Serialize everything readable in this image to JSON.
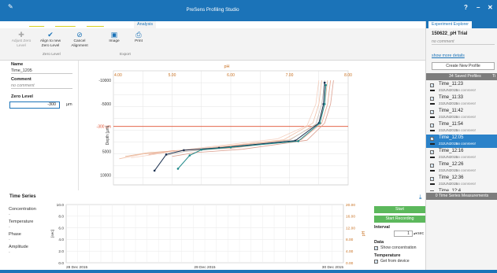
{
  "app": {
    "title": "PreSens Profiling Studio",
    "help": "?",
    "minimize": "–",
    "close": "✕"
  },
  "tabs": [
    {
      "label": "File"
    },
    {
      "label": "Devices"
    },
    {
      "label": "Calibration"
    },
    {
      "label": "Template"
    },
    {
      "label": "Profile"
    },
    {
      "label": "Analysis"
    }
  ],
  "ribbon": {
    "adjust_zero_level": "Adjust Zero Level",
    "align_to_new_zero_level": "Align to new Zero Level",
    "cancel_alignment": "Cancel Alignment",
    "image": "Image",
    "print": "Print",
    "group_zero_level": "Zero Level",
    "group_export": "Export",
    "icons": {
      "adjust": "plus-icon",
      "align": "check-icon",
      "cancel": "cancel-icon",
      "image": "image-icon",
      "print": "printer-icon"
    }
  },
  "left_panel": {
    "name_label": "Name",
    "name_value": "Time_1205",
    "comment_label": "Comment",
    "comment_value": "no comment",
    "zero_level_label": "Zero Level",
    "zero_level_value": "-300",
    "zero_level_unit": "µm"
  },
  "chart_data": {
    "type": "line",
    "x_label": "pH",
    "x_ticks": [
      "5.00",
      "6.00",
      "7.00",
      "8.00"
    ],
    "x_minor_ticks": [
      "4.00",
      "5.00",
      "6.00",
      "7.00",
      "8.00"
    ],
    "xlim": [
      4.0,
      8.0
    ],
    "y_label": "Depth [µm]",
    "y_ticks": [
      "-10000",
      "-5000",
      "-300 µm",
      "5000",
      "10000"
    ],
    "ylim": [
      -12000,
      12000
    ],
    "zero_level": -300,
    "grid": true,
    "series": [
      {
        "color": "#e8b89a",
        "points": [
          [
            7.65,
            -10000
          ],
          [
            7.6,
            -5000
          ],
          [
            7.5,
            -1000
          ],
          [
            7.0,
            2500
          ],
          [
            5.5,
            4500
          ],
          [
            4.6,
            5200
          ],
          [
            4.2,
            6000
          ]
        ]
      },
      {
        "color": "#f0c0a8",
        "points": [
          [
            7.55,
            -10000
          ],
          [
            7.5,
            -5000
          ],
          [
            7.4,
            -1000
          ],
          [
            6.9,
            2500
          ],
          [
            5.0,
            5000
          ],
          [
            4.5,
            5500
          ],
          [
            4.1,
            6500
          ]
        ]
      },
      {
        "color": "#e8a890",
        "points": [
          [
            7.7,
            -10000
          ],
          [
            7.65,
            -5000
          ],
          [
            7.55,
            -1000
          ],
          [
            7.2,
            2500
          ],
          [
            6.0,
            4300
          ],
          [
            5.0,
            4800
          ],
          [
            4.6,
            5600
          ]
        ]
      },
      {
        "color": "#f4d0c0",
        "points": [
          [
            7.5,
            -10000
          ],
          [
            7.45,
            -5000
          ],
          [
            7.3,
            -500
          ],
          [
            6.8,
            2300
          ],
          [
            5.2,
            4600
          ],
          [
            4.8,
            5400
          ],
          [
            4.3,
            6300
          ]
        ]
      },
      {
        "color": "#dca090",
        "points": [
          [
            7.75,
            -10000
          ],
          [
            7.7,
            -5000
          ],
          [
            7.6,
            -1000
          ],
          [
            7.3,
            2600
          ],
          [
            6.2,
            4500
          ],
          [
            5.4,
            5200
          ],
          [
            5.0,
            6000
          ]
        ]
      },
      {
        "color": "#c8c0b8",
        "points": [
          [
            7.6,
            -10000
          ],
          [
            7.55,
            -5000
          ],
          [
            7.45,
            -800
          ],
          [
            7.0,
            2600
          ],
          [
            5.8,
            4400
          ],
          [
            5.2,
            5000
          ],
          [
            4.9,
            5800
          ]
        ]
      },
      {
        "color": "#1a3050",
        "points": [
          [
            7.6,
            -9500
          ],
          [
            7.58,
            -5000
          ],
          [
            7.5,
            -1000
          ],
          [
            7.1,
            2700
          ],
          [
            5.8,
            4200
          ],
          [
            5.2,
            4700
          ],
          [
            4.9,
            5600
          ],
          [
            4.7,
            9000
          ]
        ]
      },
      {
        "color": "#1f8a8a",
        "points": [
          [
            7.62,
            -9000
          ],
          [
            7.6,
            -5000
          ],
          [
            7.52,
            -1000
          ],
          [
            7.15,
            2800
          ],
          [
            6.0,
            4100
          ],
          [
            5.5,
            4600
          ],
          [
            5.3,
            5800
          ],
          [
            5.1,
            8600
          ]
        ]
      }
    ]
  },
  "time_series": {
    "title": "Time Series",
    "labels": [
      {
        "label": "Concentration",
        "value": "-"
      },
      {
        "label": "Temperature",
        "value": "-"
      },
      {
        "label": "Phase",
        "value": "-"
      },
      {
        "label": "Amplitude",
        "value": "-"
      }
    ],
    "chart": {
      "left_ticks": [
        "10.0",
        "8.0",
        "6.0",
        "4.0",
        "2.0",
        "0.0"
      ],
      "right_ticks": [
        "20.00",
        "16.00",
        "12.00",
        "8.00",
        "4.00",
        "0.00"
      ],
      "right_label": "pH",
      "left_label": "[sec]",
      "x_ticks": [
        "28 Dec 2015",
        "29 Dec 2015",
        "30 Dec 2015"
      ]
    },
    "start": "Start",
    "start_recording": "Start Recording",
    "interval_label": "Interval",
    "interval_value": "1",
    "interval_unit": "sec",
    "data_label": "Data",
    "show_concentration": "Show concentration",
    "temperature_label": "Temperature",
    "get_from_device": "Get from device"
  },
  "right_panel": {
    "title": "Experiment Explorer",
    "trial_name": "150622_pH Trial",
    "trial_comment": "no comment",
    "show_more": "show more details",
    "create_profile": "Create New Profile",
    "saved_profiles": "34 Saved Profiles",
    "saved_next": "Ti",
    "ts_measurements": "0 Time Series Measurements",
    "profiles": [
      {
        "name": "Time_11:23",
        "date": "23JUN2015",
        "comment": "no comment",
        "checked": true,
        "selected": false
      },
      {
        "name": "Time_11:33",
        "date": "23JUN2015",
        "comment": "no comment",
        "checked": true,
        "selected": false
      },
      {
        "name": "Time_11:42",
        "date": "23JUN2015",
        "comment": "no comment",
        "checked": true,
        "selected": false
      },
      {
        "name": "Time_11:54",
        "date": "23JUN2015",
        "comment": "no comment",
        "checked": true,
        "selected": false
      },
      {
        "name": "Time_12:05",
        "date": "23JUN2015",
        "comment": "no comment",
        "checked": true,
        "selected": true
      },
      {
        "name": "Time_12:16",
        "date": "23JUN2015",
        "comment": "no comment",
        "checked": true,
        "selected": false
      },
      {
        "name": "Time_12:26",
        "date": "23JUN2015",
        "comment": "no comment",
        "checked": true,
        "selected": false
      },
      {
        "name": "Time_12:36",
        "date": "23JUN2015",
        "comment": "no comment",
        "checked": true,
        "selected": false
      },
      {
        "name": "Time_12:4",
        "date": "",
        "comment": "",
        "checked": true,
        "selected": false
      }
    ]
  },
  "colors": {
    "accent": "#1b73b8",
    "zero_line": "#e05030",
    "ph_axis": "#c87020",
    "start_button": "#5cb85c",
    "selected_row": "#2b82c9"
  }
}
